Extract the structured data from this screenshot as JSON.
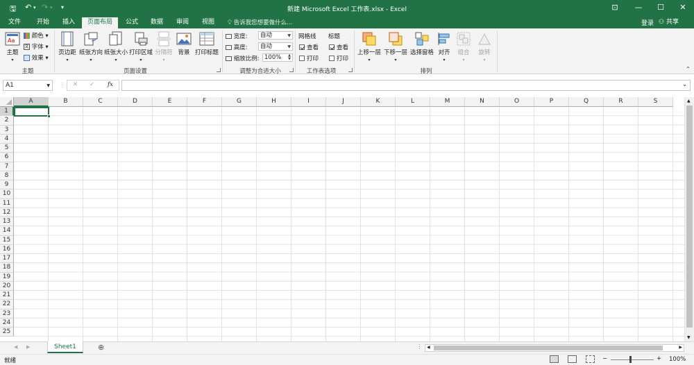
{
  "title": "新建 Microsoft Excel 工作表.xlsx - Excel",
  "quick_access": {
    "save": "🖫",
    "undo": "↶",
    "redo": "↷",
    "customize": "▾"
  },
  "window": {
    "restore_ribbon": "⊡",
    "minimize": "—",
    "maximize": "☐",
    "close": "✕"
  },
  "tabs": [
    "文件",
    "开始",
    "插入",
    "页面布局",
    "公式",
    "数据",
    "审阅",
    "视图"
  ],
  "active_tab": "页面布局",
  "tell_me": "告诉我您想要做什么...",
  "sign_in": "登录",
  "share": "共享",
  "ribbon": {
    "themes": {
      "theme": "主题",
      "colors": "颜色",
      "fonts": "字体",
      "effects": "效果",
      "group": "主题"
    },
    "page_setup": {
      "margins": "页边距",
      "orientation": "纸张方向",
      "size": "纸张大小",
      "print_area": "打印区域",
      "breaks": "分隔符",
      "background": "背景",
      "print_titles": "打印标题",
      "group": "页面设置"
    },
    "scale": {
      "width_label": "宽度:",
      "width_value": "自动",
      "height_label": "高度:",
      "height_value": "自动",
      "scale_label": "缩放比例:",
      "scale_value": "100%",
      "group": "调整为合适大小"
    },
    "sheet_options": {
      "gridlines": "网格线",
      "headings": "标题",
      "view": "查看",
      "print": "打印",
      "group": "工作表选项"
    },
    "arrange": {
      "bring_forward": "上移一层",
      "send_backward": "下移一层",
      "selection_pane": "选择窗格",
      "align": "对齐",
      "group_btn": "组合",
      "rotate": "旋转",
      "group": "排列"
    }
  },
  "formula_bar": {
    "name_box": "A1",
    "cancel": "✕",
    "enter": "✓",
    "fx": "fx",
    "formula": ""
  },
  "columns": [
    "A",
    "B",
    "C",
    "D",
    "E",
    "F",
    "G",
    "H",
    "I",
    "J",
    "K",
    "L",
    "M",
    "N",
    "O",
    "P",
    "Q",
    "R",
    "S"
  ],
  "rows": [
    "1",
    "2",
    "3",
    "4",
    "5",
    "6",
    "7",
    "8",
    "9",
    "10",
    "11",
    "12",
    "13",
    "14",
    "15",
    "16",
    "17",
    "18",
    "19",
    "20",
    "21",
    "22",
    "23",
    "24",
    "25"
  ],
  "sheet_tabs": [
    "Sheet1"
  ],
  "add_sheet": "⊕",
  "status": {
    "ready": "就绪",
    "zoom": "100%"
  },
  "colors": {
    "accent": "#217346",
    "ribbon_bg": "#f3f3f3"
  }
}
